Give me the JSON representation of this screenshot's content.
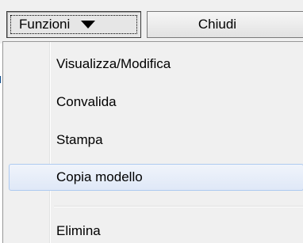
{
  "toolbar": {
    "funzioni_label": "Funzioni",
    "chiudi_label": "Chiudi"
  },
  "menu": {
    "items": [
      {
        "label": "Visualizza/Modifica"
      },
      {
        "label": "Convalida"
      },
      {
        "label": "Stampa"
      },
      {
        "label": "Copia modello",
        "highlighted": true
      },
      {
        "label": "Elimina"
      }
    ]
  },
  "colors": {
    "highlight_border": "#aecaf0",
    "highlight_fill": "#dfe8f7",
    "menu_background": "#f0f0f0"
  },
  "icons": {
    "dropdown_caret": "caret-down-icon"
  }
}
